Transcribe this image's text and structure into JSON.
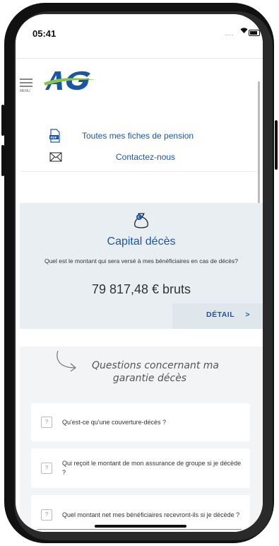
{
  "status_bar": {
    "time": "05:41",
    "signal": "....."
  },
  "app_bar": {
    "menu_label": "MENU",
    "logo_text": "AG"
  },
  "links": [
    {
      "label": "Toutes mes fiches de pension",
      "icon": "pdf-file-icon"
    },
    {
      "label": "Contactez-nous",
      "icon": "envelope-icon"
    }
  ],
  "capital_card": {
    "title": "Capital décès",
    "question": "Quel est le montant qui sera versé à mes bénéficiaires en cas de décès?",
    "amount": "79 817,48 € bruts",
    "detail_label": "DÉTAIL",
    "detail_chevron": ">"
  },
  "faq": {
    "heading_line1": "Questions concernant ma",
    "heading_line2": "garantie décès",
    "items": [
      {
        "label": "Qu'est-ce qu'une couverture-décès ?"
      },
      {
        "label": "Qui reçoit le montant de mon assurance de groupe si je décède ?"
      },
      {
        "label": "Quel montant net mes bénéficiaires recevront-ils si je décède ?"
      }
    ]
  },
  "colors": {
    "brand_blue": "#1a56a8",
    "brand_green": "#8dc63f",
    "card_bg": "#e9eef2"
  }
}
